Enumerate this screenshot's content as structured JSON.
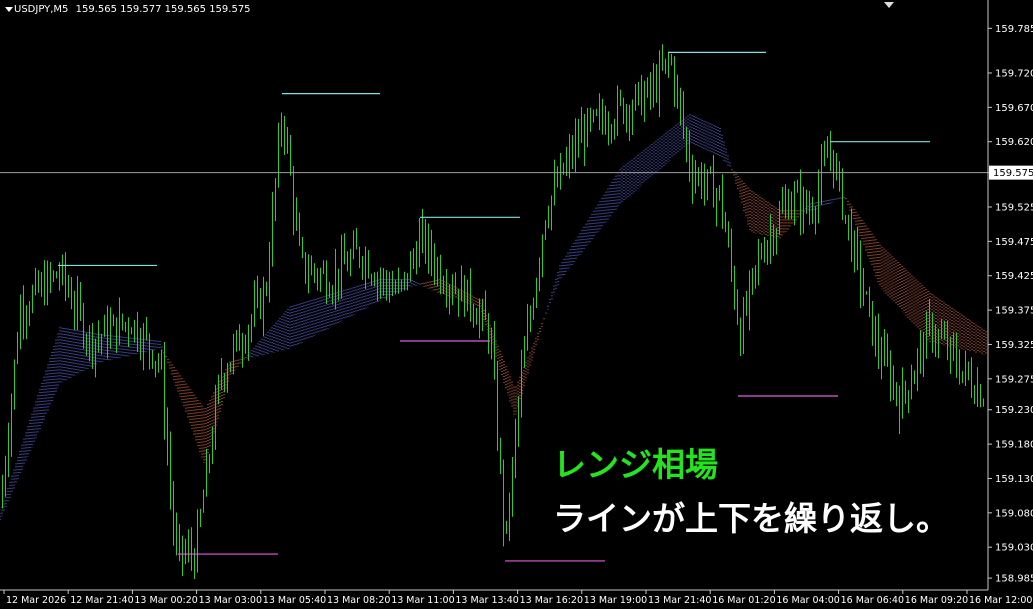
{
  "header": {
    "symbol": "USDJPY,M5",
    "ohlc": "159.565 159.577 159.565 159.575"
  },
  "captions": {
    "line1": "レンジ相場",
    "line2": "ラインが上下を繰り返し。"
  },
  "colors": {
    "background": "#000000",
    "candles": "#32c832",
    "band_up": "#6f79ff",
    "band_down": "#ff7a4a",
    "resistance": "#7fe0e0",
    "support": "#e05ce0",
    "current_price_line": "#9e9e9e",
    "axis_text": "#ffffff",
    "caption1": "#22e51d",
    "caption2": "#ffffff"
  },
  "chart_data": {
    "type": "line",
    "title": "USDJPY,M5",
    "ylim": [
      158.975,
      159.8
    ],
    "current_price": 159.575,
    "y_ticks": [
      "159.785",
      "159.720",
      "159.670",
      "159.620",
      "159.575",
      "159.525",
      "159.475",
      "159.425",
      "159.375",
      "159.325",
      "159.275",
      "159.230",
      "159.180",
      "159.130",
      "159.080",
      "159.030",
      "158.985"
    ],
    "x_labels": [
      "12 Mar 2026",
      "12 Mar 21:40",
      "13 Mar 00:20",
      "13 Mar 03:00",
      "13 Mar 05:40",
      "13 Mar 08:20",
      "13 Mar 11:00",
      "13 Mar 13:40",
      "13 Mar 16:20",
      "13 Mar 19:00",
      "13 Mar 21:40",
      "16 Mar 01:20",
      "16 Mar 04:00",
      "16 Mar 06:40",
      "16 Mar 09:20",
      "16 Mar 12:00"
    ],
    "price_path": [
      [
        0,
        159.09
      ],
      [
        20,
        159.38
      ],
      [
        60,
        159.43
      ],
      [
        90,
        159.33
      ],
      [
        130,
        159.36
      ],
      [
        160,
        159.3
      ],
      [
        175,
        159.02
      ],
      [
        195,
        159.02
      ],
      [
        220,
        159.28
      ],
      [
        265,
        159.4
      ],
      [
        282,
        159.67
      ],
      [
        300,
        159.44
      ],
      [
        330,
        159.42
      ],
      [
        360,
        159.46
      ],
      [
        380,
        159.42
      ],
      [
        400,
        159.4
      ],
      [
        420,
        159.48
      ],
      [
        440,
        159.43
      ],
      [
        470,
        159.39
      ],
      [
        490,
        159.34
      ],
      [
        505,
        159.03
      ],
      [
        520,
        159.27
      ],
      [
        545,
        159.52
      ],
      [
        580,
        159.63
      ],
      [
        610,
        159.66
      ],
      [
        650,
        159.69
      ],
      [
        670,
        159.74
      ],
      [
        690,
        159.58
      ],
      [
        720,
        159.54
      ],
      [
        740,
        159.34
      ],
      [
        760,
        159.46
      ],
      [
        790,
        159.54
      ],
      [
        810,
        159.52
      ],
      [
        830,
        159.61
      ],
      [
        850,
        159.48
      ],
      [
        875,
        159.33
      ],
      [
        900,
        159.24
      ],
      [
        930,
        159.35
      ],
      [
        960,
        159.29
      ],
      [
        990,
        159.24
      ]
    ],
    "band": [
      [
        0,
        159.08,
        159.07
      ],
      [
        60,
        159.35,
        159.27
      ],
      [
        100,
        159.34,
        159.3
      ],
      [
        160,
        159.33,
        159.32
      ],
      [
        205,
        159.15,
        159.23
      ],
      [
        230,
        159.28,
        159.3
      ],
      [
        290,
        159.38,
        159.32
      ],
      [
        380,
        159.42,
        159.39
      ],
      [
        410,
        159.42,
        159.41
      ],
      [
        440,
        159.4,
        159.42
      ],
      [
        480,
        159.38,
        159.39
      ],
      [
        515,
        159.22,
        159.26
      ],
      [
        560,
        159.44,
        159.42
      ],
      [
        620,
        159.58,
        159.53
      ],
      [
        690,
        159.66,
        159.62
      ],
      [
        720,
        159.64,
        159.6
      ],
      [
        750,
        159.49,
        159.55
      ],
      [
        780,
        159.48,
        159.52
      ],
      [
        810,
        159.53,
        159.52
      ],
      [
        845,
        159.54,
        159.54
      ],
      [
        880,
        159.41,
        159.47
      ],
      [
        930,
        159.33,
        159.4
      ],
      [
        990,
        159.31,
        159.34
      ]
    ],
    "resistance_levels": [
      {
        "x1": 58,
        "x2": 157,
        "value": 159.44
      },
      {
        "x1": 282,
        "x2": 380,
        "value": 159.69
      },
      {
        "x1": 420,
        "x2": 520,
        "value": 159.51
      },
      {
        "x1": 668,
        "x2": 766,
        "value": 159.75
      },
      {
        "x1": 830,
        "x2": 930,
        "value": 159.62
      }
    ],
    "support_levels": [
      {
        "x1": 178,
        "x2": 278,
        "value": 159.02
      },
      {
        "x1": 400,
        "x2": 490,
        "value": 159.33
      },
      {
        "x1": 505,
        "x2": 605,
        "value": 159.01
      },
      {
        "x1": 738,
        "x2": 838,
        "value": 159.25
      }
    ]
  }
}
